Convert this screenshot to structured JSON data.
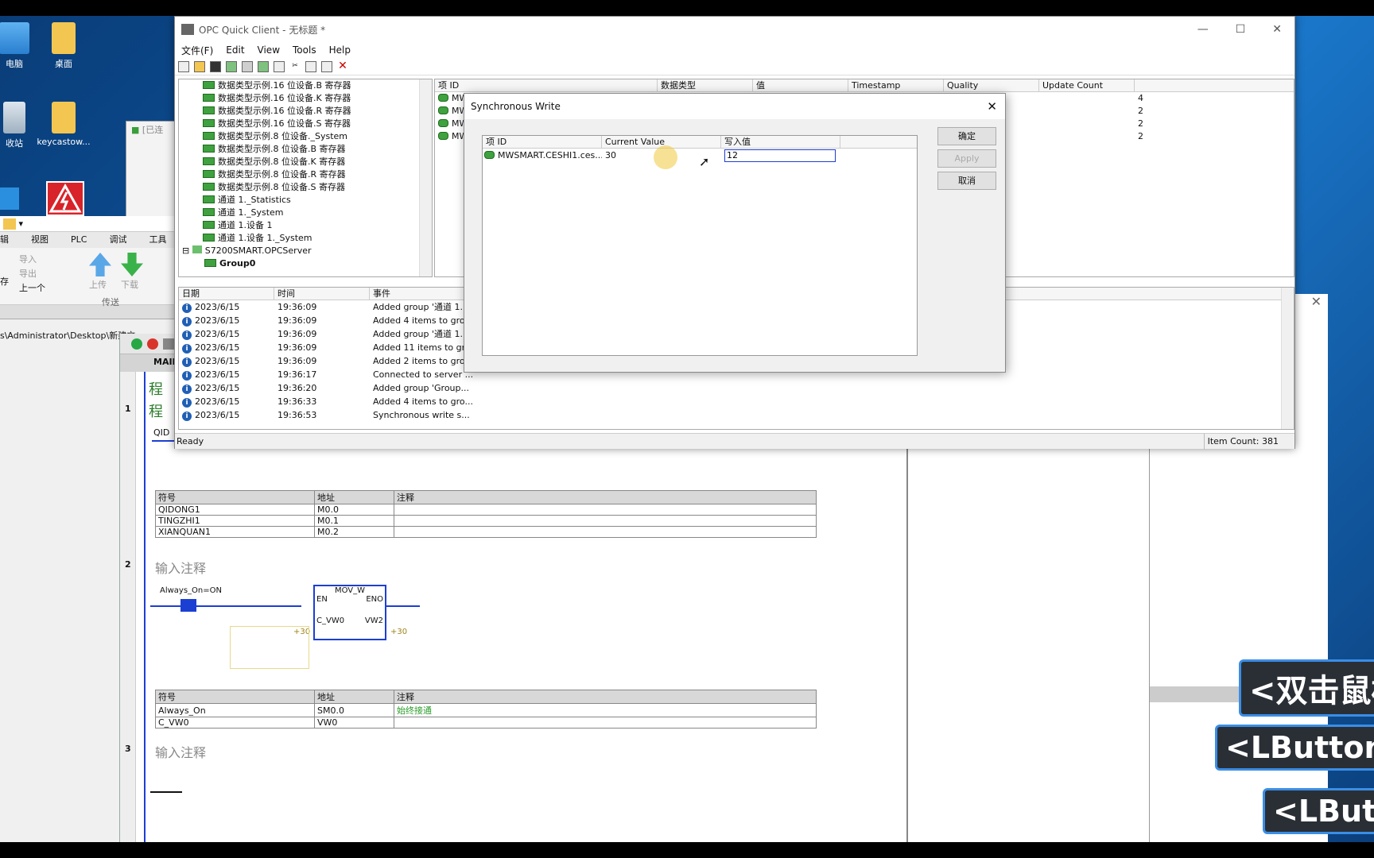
{
  "desktop": {
    "icons": [
      {
        "label": "电脑"
      },
      {
        "label": "桌面"
      },
      {
        "label": "收站"
      },
      {
        "label": "keycastow..."
      }
    ]
  },
  "step7": {
    "ribbon_tabs": [
      "辑",
      "视图",
      "PLC",
      "调试",
      "工具"
    ],
    "ribbon_items": {
      "import": "导入",
      "export": "导出",
      "upload": "上传",
      "download": "下载",
      "prev": "上一个",
      "group_label": "传送",
      "save": "存"
    },
    "path": "s\\Administrator\\Desktop\\新建文",
    "tab_label": "MAIN",
    "prog_label": "程",
    "networks": [
      {
        "num": "1",
        "title": "程",
        "contact": "QID",
        "symbols": {
          "headers": [
            "符号",
            "地址",
            "注释"
          ],
          "rows": [
            [
              "QIDONG1",
              "M0.0",
              ""
            ],
            [
              "TINGZHI1",
              "M0.1",
              ""
            ],
            [
              "XIANQUAN1",
              "M0.2",
              ""
            ]
          ]
        }
      },
      {
        "num": "2",
        "title": "输入注释",
        "contact": "Always_On=ON",
        "box": {
          "name": "MOV_W",
          "en": "EN",
          "eno": "ENO",
          "in": "C_VW0",
          "out": "VW2",
          "in_val": "+30",
          "out_val": "+30"
        },
        "symbols": {
          "headers": [
            "符号",
            "地址",
            "注释"
          ],
          "rows": [
            [
              "Always_On",
              "SM0.0",
              "始终接通"
            ],
            [
              "C_VW0",
              "VW0",
              ""
            ]
          ]
        }
      },
      {
        "num": "3",
        "title": "输入注释"
      }
    ],
    "other_window_title": "[已连"
  },
  "opc": {
    "title": "OPC Quick Client - 无标题 *",
    "menu": [
      "文件(F)",
      "Edit",
      "View",
      "Tools",
      "Help"
    ],
    "tree": [
      "数据类型示例.16 位设备.B 寄存器",
      "数据类型示例.16 位设备.K 寄存器",
      "数据类型示例.16 位设备.R 寄存器",
      "数据类型示例.16 位设备.S 寄存器",
      "数据类型示例.8 位设备._System",
      "数据类型示例.8 位设备.B 寄存器",
      "数据类型示例.8 位设备.K 寄存器",
      "数据类型示例.8 位设备.R 寄存器",
      "数据类型示例.8 位设备.S 寄存器",
      "通道 1._Statistics",
      "通道 1._System",
      "通道 1.设备 1",
      "通道 1.设备 1._System"
    ],
    "server": "S7200SMART.OPCServer",
    "group": "Group0",
    "grid": {
      "headers": [
        "项 ID",
        "数据类型",
        "值",
        "Timestamp",
        "Quality",
        "Update Count"
      ],
      "rows": [
        {
          "id": "MW",
          "count": "4"
        },
        {
          "id": "MW",
          "count": "2"
        },
        {
          "id": "MW",
          "count": "2"
        },
        {
          "id": "MW",
          "count": "2"
        }
      ]
    },
    "log": {
      "headers": [
        "日期",
        "时间",
        "事件"
      ],
      "rows": [
        [
          "2023/6/15",
          "19:36:09",
          "Added group '通道 1..."
        ],
        [
          "2023/6/15",
          "19:36:09",
          "Added 4 items to gro..."
        ],
        [
          "2023/6/15",
          "19:36:09",
          "Added group '通道 1..."
        ],
        [
          "2023/6/15",
          "19:36:09",
          "Added 11 items to gr..."
        ],
        [
          "2023/6/15",
          "19:36:09",
          "Added 2 items to gro..."
        ],
        [
          "2023/6/15",
          "19:36:17",
          "Connected to server ..."
        ],
        [
          "2023/6/15",
          "19:36:20",
          "Added group 'Group..."
        ],
        [
          "2023/6/15",
          "19:36:33",
          "Added 4 items to gro..."
        ],
        [
          "2023/6/15",
          "19:36:53",
          "Synchronous write s..."
        ]
      ]
    },
    "status_left": "Ready",
    "status_right": "Item Count: 381"
  },
  "dialog": {
    "title": "Synchronous Write",
    "headers": [
      "项 ID",
      "Current Value",
      "写入值"
    ],
    "row": {
      "id": "MWSMART.CESHI1.ces...",
      "current": "30",
      "write": "12"
    },
    "ok": "确定",
    "apply": "Apply",
    "cancel": "取消"
  },
  "keycast": [
    "<双击鼠标",
    "<LButton",
    "<LButt"
  ]
}
